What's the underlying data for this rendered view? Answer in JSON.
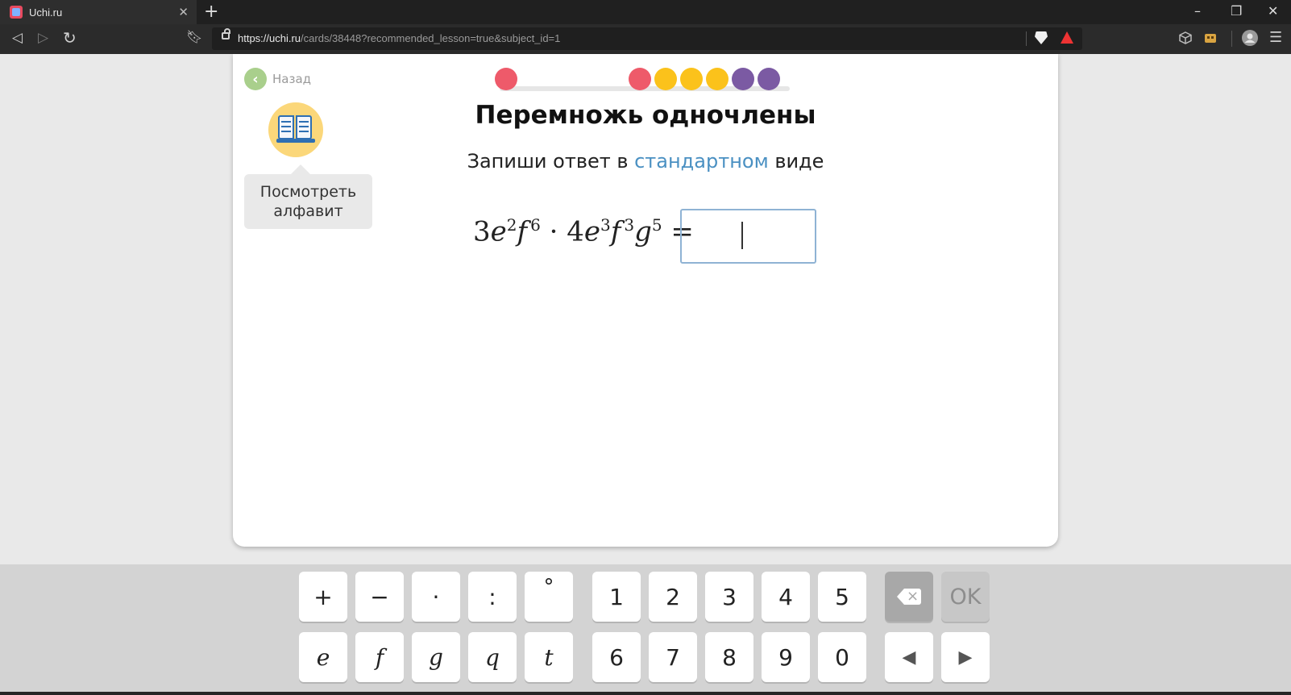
{
  "browser": {
    "tab_title": "Uchi.ru",
    "tab_close": "✕",
    "new_tab": "+",
    "url_domain": "https://uchi.ru",
    "url_path": "/cards/38448?recommended_lesson=true&subject_id=1",
    "window_controls": {
      "minimize": "–",
      "restore": "❐",
      "close": "✕"
    }
  },
  "page": {
    "back_label": "Назад",
    "alphabet_button": [
      "Посмотреть",
      "алфавит"
    ],
    "title": "Перемножь одночлены",
    "subtitle": {
      "before": "Запиши ответ в ",
      "link": "стандартном",
      "after": " виде"
    },
    "expression": {
      "c1": "3",
      "v1": "e",
      "e1": "2",
      "v2": "f",
      "e2": "6",
      "dot": " · ",
      "c2": "4",
      "v3": "e",
      "e3": "3",
      "v4": "f",
      "e4": "3",
      "v5": "g",
      "e5": "5",
      "equals": " ="
    },
    "answer_value": ""
  },
  "progress": {
    "colors": {
      "red": "#ee5a6a",
      "yellow": "#fbc21b",
      "purple": "#7b5aa3"
    },
    "dots": [
      "red",
      "red",
      "yellow",
      "yellow",
      "yellow",
      "purple",
      "purple"
    ]
  },
  "keyboard": {
    "row1": [
      "+",
      "−",
      "·",
      ":",
      "°",
      "1",
      "2",
      "3",
      "4",
      "5"
    ],
    "row2": [
      "e",
      "f",
      "g",
      "q",
      "t",
      "6",
      "7",
      "8",
      "9",
      "0"
    ],
    "ok": "OK",
    "left_arrow": "◀",
    "right_arrow": "▶"
  }
}
